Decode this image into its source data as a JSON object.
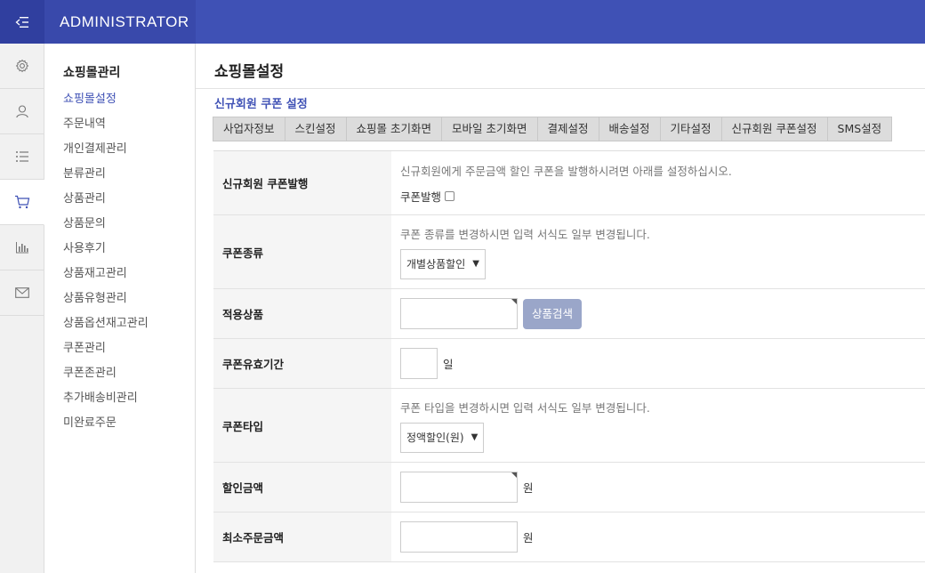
{
  "header": {
    "brand": "ADMINISTRATOR"
  },
  "icon_sidebar": [
    {
      "icon": "menu-collapse-icon"
    },
    {
      "icon": "gear-icon"
    },
    {
      "icon": "user-icon"
    },
    {
      "icon": "list-icon"
    },
    {
      "icon": "cart-icon",
      "active": true
    },
    {
      "icon": "bar-chart-icon"
    },
    {
      "icon": "mail-icon"
    }
  ],
  "subnav": {
    "title": "쇼핑몰관리",
    "items": [
      {
        "label": "쇼핑몰설정"
      },
      {
        "label": "주문내역"
      },
      {
        "label": "개인결제관리"
      },
      {
        "label": "분류관리"
      },
      {
        "label": "상품관리"
      },
      {
        "label": "상품문의"
      },
      {
        "label": "사용후기"
      },
      {
        "label": "상품재고관리"
      },
      {
        "label": "상품유형관리"
      },
      {
        "label": "상품옵션재고관리"
      },
      {
        "label": "쿠폰관리"
      },
      {
        "label": "쿠폰존관리"
      },
      {
        "label": "추가배송비관리"
      },
      {
        "label": "미완료주문"
      }
    ]
  },
  "main": {
    "page_title": "쇼핑몰설정",
    "section_title": "신규회원 쿠폰 설정",
    "tabs": [
      "사업자정보",
      "스킨설정",
      "쇼핑몰 초기화면",
      "모바일 초기화면",
      "결제설정",
      "배송설정",
      "기타설정",
      "신규회원 쿠폰설정",
      "SMS설정"
    ]
  },
  "form": {
    "issue": {
      "label": "신규회원 쿠폰발행",
      "help": "신규회원에게 주문금액 할인 쿠폰을 발행하시려면 아래를 설정하십시오.",
      "checkbox_label": "쿠폰발행"
    },
    "coupon_type": {
      "label": "쿠폰종류",
      "help": "쿠폰 종류를 변경하시면 입력 서식도 일부 변경됩니다.",
      "selected": "개별상품할인"
    },
    "product": {
      "label": "적용상품",
      "value": "",
      "button": "상품검색"
    },
    "period": {
      "label": "쿠폰유효기간",
      "value": "",
      "unit": "일"
    },
    "discount_type": {
      "label": "쿠폰타입",
      "help": "쿠폰 타입을 변경하시면 입력 서식도 일부 변경됩니다.",
      "selected": "정액할인(원)"
    },
    "amount": {
      "label": "할인금액",
      "value": "",
      "unit": "원"
    },
    "min_order": {
      "label": "최소주문금액",
      "value": "",
      "unit": "원"
    }
  }
}
